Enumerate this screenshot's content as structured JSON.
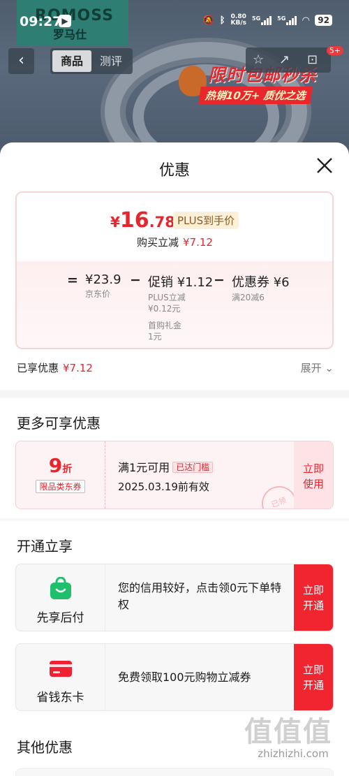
{
  "status_bar": {
    "time": "09:27",
    "net_speed_value": "0.80",
    "net_speed_unit": "KB/s",
    "signal_label_1": "5G",
    "signal_label_2": "5G",
    "battery": "92"
  },
  "background_page": {
    "brand_top": "ROMOSS",
    "brand_bottom": "罗马仕",
    "tabs": [
      {
        "label": "商品",
        "active": true
      },
      {
        "label": "测评",
        "active": false
      }
    ],
    "cart_badge": "5+",
    "promo_title": "限时包邮秒杀",
    "promo_subtitle": "热销10万+ 质优之选"
  },
  "sheet": {
    "title": "优惠",
    "final_price": {
      "currency": "¥",
      "integer": "16",
      "decimal": ".78"
    },
    "plus_label": "PLUS到手价",
    "buy_reduce_label": "购买立减",
    "buy_reduce_value": "¥7.12",
    "formula": {
      "eq": "=",
      "minus": "−",
      "items": [
        {
          "value": "¥23.9",
          "label": "京东价"
        },
        {
          "value": "促销 ¥1.12",
          "label": "PLUS立减",
          "label2": "¥0.12元",
          "label3": "首购礼金",
          "label4": "1元"
        },
        {
          "value": "优惠券 ¥6",
          "label": "满20减6"
        }
      ]
    },
    "enjoyed_label": "已享优惠",
    "enjoyed_value": "¥7.12",
    "expand_label": "展开"
  },
  "more_offers": {
    "title": "更多可享优惠",
    "coupon": {
      "discount": "9",
      "discount_unit": "折",
      "scope_tag": "限品类东券",
      "condition": "满1元可用",
      "status_pill": "已达门槛",
      "expiry": "2025.03.19前有效",
      "action_line1": "立即",
      "action_line2": "使用",
      "stamp": "已领"
    }
  },
  "open_enjoy": {
    "title": "开通立享",
    "cards": [
      {
        "name": "先享后付",
        "desc": "您的信用较好，点击领0元下单特权",
        "action_line1": "立即",
        "action_line2": "开通",
        "icon_color": "#1fbf6b"
      },
      {
        "name": "省钱东卡",
        "desc": "免费领取100元购物立减券",
        "action_line1": "立即",
        "action_line2": "开通",
        "icon_color": "#ee2233"
      }
    ]
  },
  "other_offers": {
    "title": "其他优惠"
  },
  "watermark": {
    "glyphs": "值值值",
    "text": "zhizhizhi.com"
  }
}
